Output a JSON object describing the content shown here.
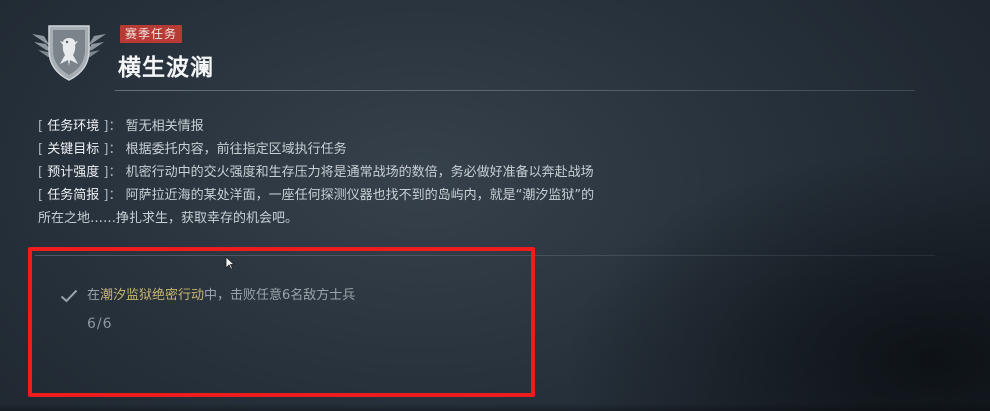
{
  "header": {
    "tag": "赛季任务",
    "title": "横生波澜",
    "emblem_icon": "eagle-emblem-icon"
  },
  "info": {
    "rows": [
      {
        "label": "任务环境",
        "value": "暂无相关情报"
      },
      {
        "label": "关键目标",
        "value": "根据委托内容，前往指定区域执行任务"
      },
      {
        "label": "预计强度",
        "value": "机密行动中的交火强度和生存压力将是通常战场的数倍，务必做好准备以奔赴战场"
      },
      {
        "label": "任务简报",
        "value": "阿萨拉近海的某处洋面，一座任何探测仪器也找不到的岛屿内，就是“潮汐监狱”的"
      }
    ],
    "continuation": "所在之地……挣扎求生，获取幸存的机会吧。",
    "bracket_open": "[",
    "bracket_close": "]",
    "separator": "："
  },
  "objective": {
    "prefix": "在",
    "highlight": "潮汐监狱绝密行动",
    "suffix": "中，击败任意6名敌方士兵",
    "progress": "6/6",
    "status_icon": "checkmark-icon",
    "completed": true
  },
  "colors": {
    "tag_bg": "#b83a35",
    "highlight_text": "#c9b56f",
    "annotation_box": "#ee1c1c"
  }
}
